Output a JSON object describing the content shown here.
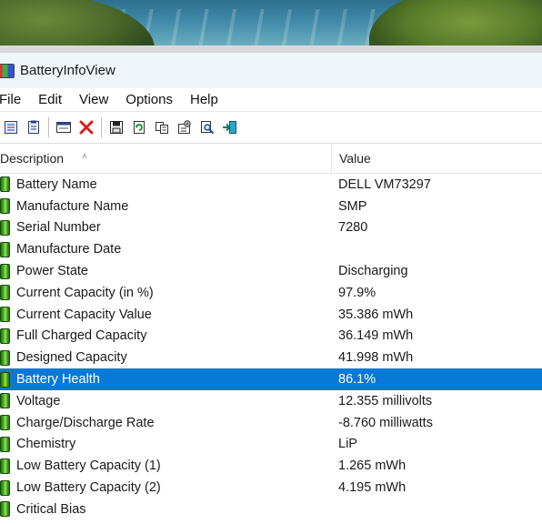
{
  "window": {
    "title": "BatteryInfoView"
  },
  "menu": [
    "File",
    "Edit",
    "View",
    "Options",
    "Help"
  ],
  "toolbar": {
    "icons": [
      "html-report-icon",
      "text-report-icon",
      "properties-icon",
      "delete-icon",
      "save-icon",
      "refresh-icon",
      "copy-icon",
      "options-icon",
      "find-icon",
      "exit-icon"
    ]
  },
  "columns": {
    "description": "Description",
    "value": "Value"
  },
  "colors": {
    "selection": "#0a78d7",
    "battery_green": "#3d9a1c"
  },
  "rows": [
    {
      "label": "Battery Name",
      "value": "DELL VM73297"
    },
    {
      "label": "Manufacture Name",
      "value": "SMP"
    },
    {
      "label": "Serial Number",
      "value": "7280"
    },
    {
      "label": "Manufacture Date",
      "value": ""
    },
    {
      "label": "Power State",
      "value": "Discharging"
    },
    {
      "label": "Current Capacity (in %)",
      "value": "97.9%"
    },
    {
      "label": "Current Capacity Value",
      "value": "35.386 mWh"
    },
    {
      "label": "Full Charged Capacity",
      "value": "36.149 mWh"
    },
    {
      "label": "Designed Capacity",
      "value": "41.998 mWh"
    },
    {
      "label": "Battery Health",
      "value": "86.1%",
      "selected": true
    },
    {
      "label": "Voltage",
      "value": "12.355 millivolts"
    },
    {
      "label": "Charge/Discharge Rate",
      "value": "-8.760 milliwatts"
    },
    {
      "label": "Chemistry",
      "value": "LiP"
    },
    {
      "label": "Low Battery Capacity (1)",
      "value": "1.265 mWh"
    },
    {
      "label": "Low Battery Capacity (2)",
      "value": "4.195 mWh"
    },
    {
      "label": "Critical Bias",
      "value": ""
    }
  ]
}
